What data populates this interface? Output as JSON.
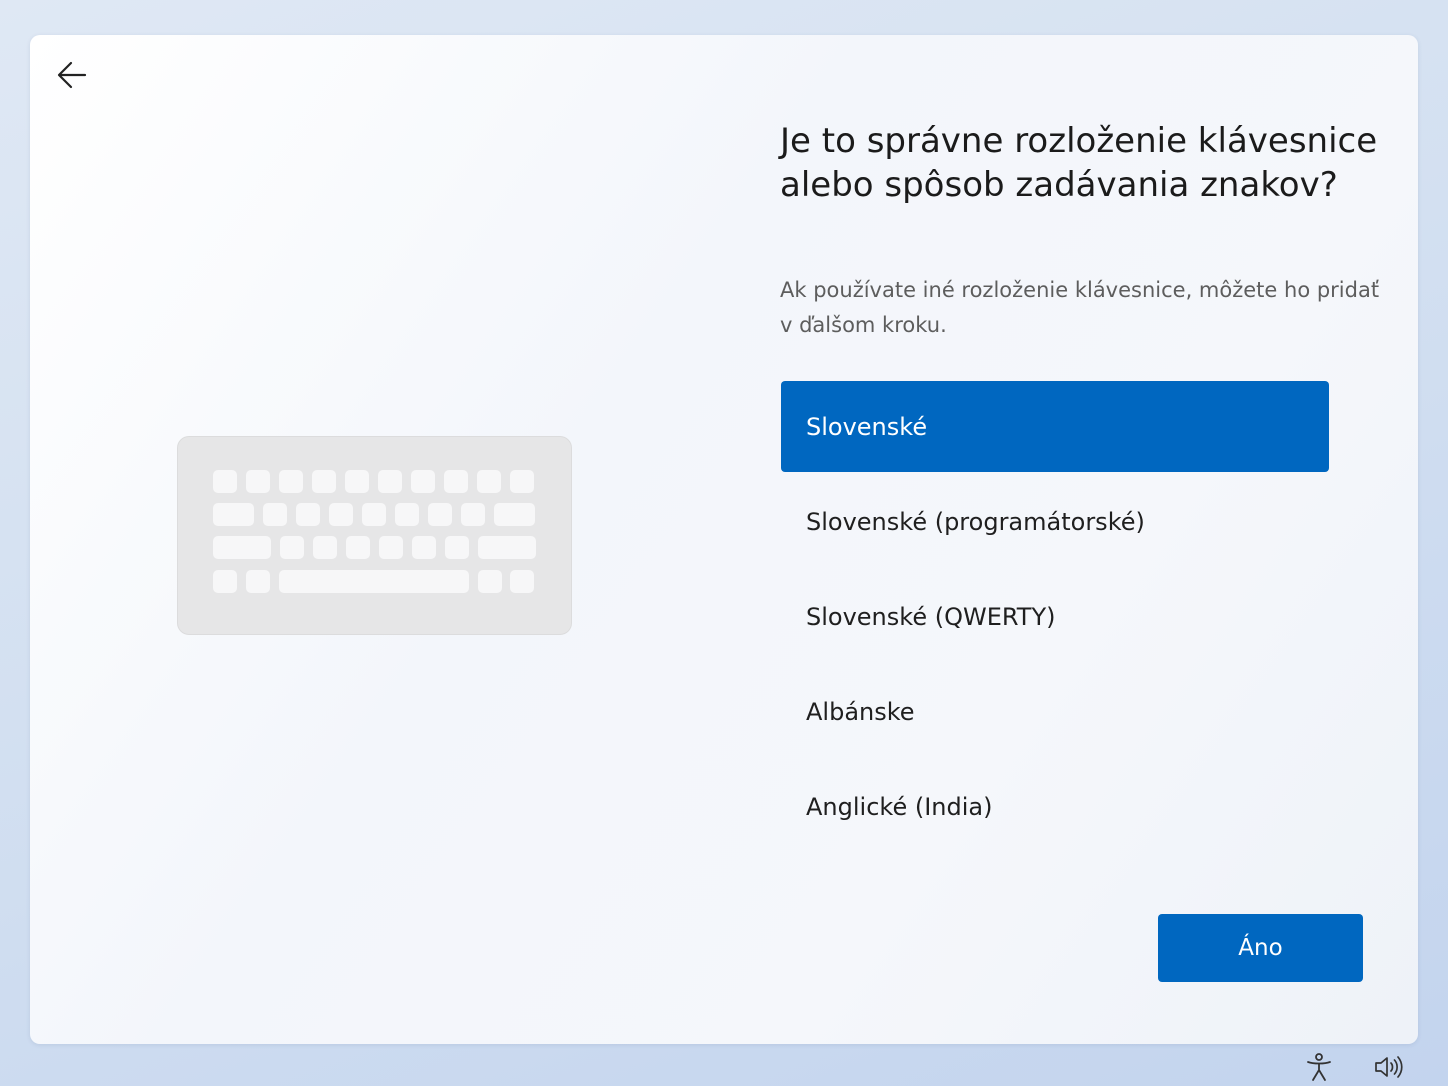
{
  "header": {
    "title": "Je to správne rozloženie klávesnice alebo spôsob zadávania znakov?",
    "subtitle": "Ak používate iné rozloženie klávesnice, môžete ho pridať v ďalšom kroku."
  },
  "layouts": {
    "selected_index": 0,
    "items": [
      "Slovenské",
      "Slovenské (programátorské)",
      "Slovenské (QWERTY)",
      "Albánske",
      "Anglické (India)"
    ]
  },
  "actions": {
    "confirm_label": "Áno"
  },
  "icons": {
    "back": "arrow-left-icon",
    "accessibility": "accessibility-icon",
    "volume": "volume-icon",
    "illustration": "keyboard-icon"
  },
  "colors": {
    "accent": "#0067c0",
    "illustration": "#e6e6e7"
  }
}
